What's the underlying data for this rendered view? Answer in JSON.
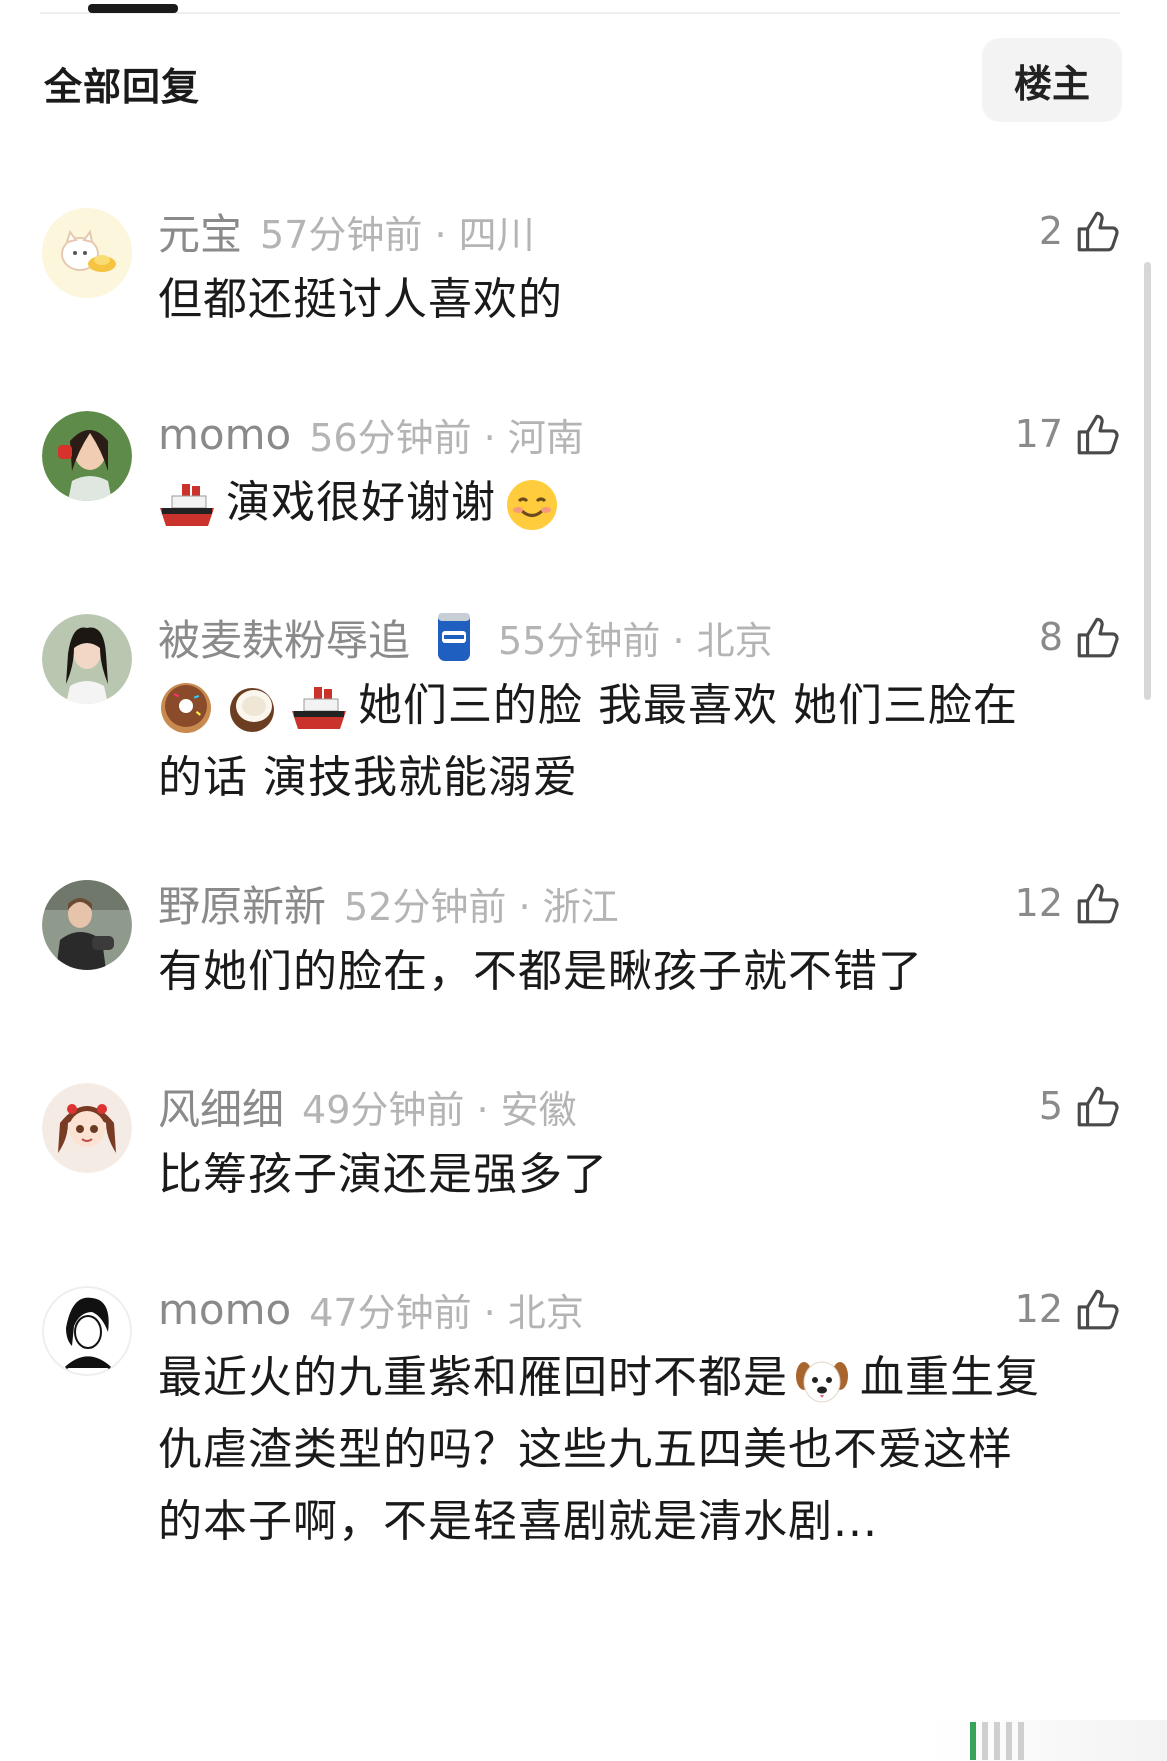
{
  "header": {
    "title": "全部回复",
    "op_button": "楼主"
  },
  "comments": [
    {
      "username": "元宝",
      "time": "57分钟前",
      "location": "四川",
      "likes": "2",
      "text": "但都还挺讨人喜欢的",
      "avatar": "cat-sticker"
    },
    {
      "username": "momo",
      "time": "56分钟前",
      "location": "河南",
      "likes": "17",
      "text": "演戏很好谢谢",
      "avatar": "girl-photo",
      "emojis": [
        "ship-emoji",
        "smiling-face-emoji"
      ]
    },
    {
      "username": "被麦麸粉辱追",
      "time": "55分钟前",
      "location": "北京",
      "likes": "8",
      "text_line1": "她们三的脸 我最喜欢 她们三脸在",
      "text_line2": "的话 演技我就能溺爱",
      "avatar": "woman-photo",
      "badge": "beer-can-icon",
      "emojis": [
        "donut-emoji",
        "coconut-emoji",
        "ship-emoji"
      ]
    },
    {
      "username": "野原新新",
      "time": "52分钟前",
      "location": "浙江",
      "likes": "12",
      "text": "有她们的脸在，不都是瞅孩子就不错了",
      "avatar": "man-photo"
    },
    {
      "username": "风细细",
      "time": "49分钟前",
      "location": "安徽",
      "likes": "5",
      "text": "比筹孩子演还是强多了",
      "avatar": "cartoon-girl"
    },
    {
      "username": "momo",
      "time": "47分钟前",
      "location": "北京",
      "likes": "12",
      "text_line1_a": "最近火的九重紫和雁回时不都是",
      "text_line1_b": "血重生复",
      "text_line2": "仇虐渣类型的吗？这些九五四美也不爱这样",
      "text_line3": "的本子啊，不是轻喜剧就是清水剧...",
      "avatar": "sketch-portrait",
      "emojis": [
        "dog-face-emoji"
      ]
    }
  ],
  "colors": {
    "username": "#8a8a8a",
    "meta": "#b4b4b4",
    "text": "#1a1a1a"
  }
}
